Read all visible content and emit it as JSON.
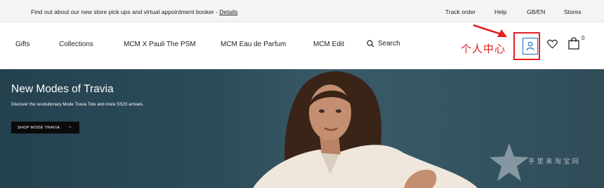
{
  "announcement": {
    "text": "Find out about our new store pick ups and virtual appointment booker - ",
    "link": "Details"
  },
  "utility_links": [
    "Track order",
    "Help",
    "GB/EN",
    "Stores"
  ],
  "nav": {
    "items": [
      "Gifts",
      "Collections",
      "MCM X Pauli The PSM",
      "MCM Eau de Parfum",
      "MCM Edit"
    ],
    "search_label": "Search",
    "bag_count": "0"
  },
  "annotation": {
    "label": "个人中心",
    "color": "#e02020"
  },
  "hero": {
    "title": "New Modes of Travia",
    "subtitle": "Discover the revolutionary Mode Travia Tote and more SS23 arrivals.",
    "cta": "SHOP MODE TRAVIA"
  },
  "watermark": {
    "text": "手里来淘宝网"
  }
}
